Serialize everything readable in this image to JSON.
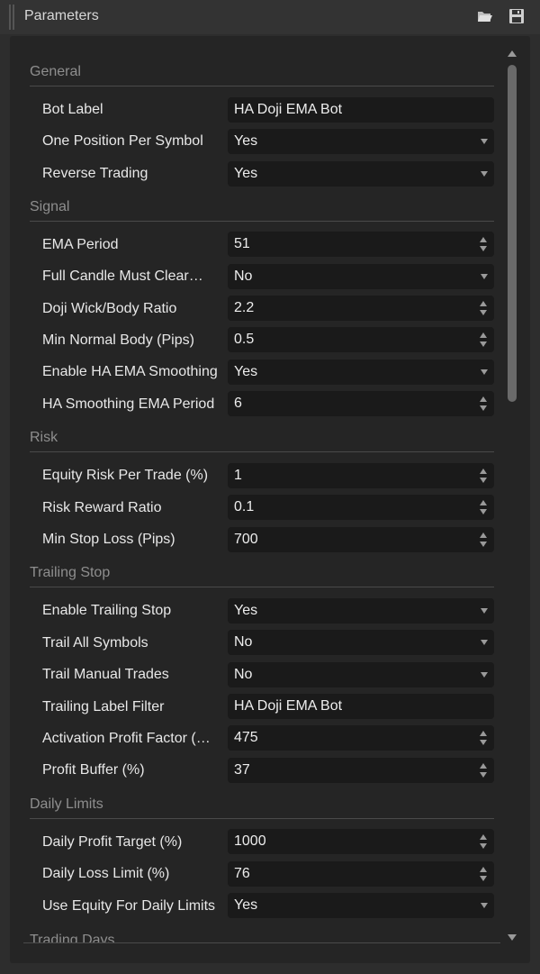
{
  "panel": {
    "title": "Parameters",
    "open_icon": "folder-open-icon",
    "save_icon": "save-icon"
  },
  "sections": {
    "general": {
      "title": "General",
      "bot_label": {
        "label": "Bot Label",
        "value": "HA Doji EMA Bot"
      },
      "one_position": {
        "label": "One Position Per Symbol",
        "value": "Yes"
      },
      "reverse_trading": {
        "label": "Reverse Trading",
        "value": "Yes"
      }
    },
    "signal": {
      "title": "Signal",
      "ema_period": {
        "label": "EMA Period",
        "value": "51"
      },
      "full_candle": {
        "label": "Full Candle Must Clear…",
        "value": "No"
      },
      "doji_ratio": {
        "label": "Doji Wick/Body Ratio",
        "value": "2.2"
      },
      "min_body": {
        "label": "Min Normal Body (Pips)",
        "value": "0.5"
      },
      "ha_smoothing": {
        "label": "Enable HA EMA Smoothing",
        "value": "Yes"
      },
      "ha_period": {
        "label": "HA Smoothing EMA Period",
        "value": "6"
      }
    },
    "risk": {
      "title": "Risk",
      "equity_risk": {
        "label": "Equity Risk Per Trade (%)",
        "value": "1"
      },
      "rr_ratio": {
        "label": "Risk Reward Ratio",
        "value": "0.1"
      },
      "min_sl": {
        "label": "Min Stop Loss (Pips)",
        "value": "700"
      }
    },
    "trailing": {
      "title": "Trailing Stop",
      "enable": {
        "label": "Enable Trailing Stop",
        "value": "Yes"
      },
      "all_symbols": {
        "label": "Trail All Symbols",
        "value": "No"
      },
      "manual": {
        "label": "Trail Manual Trades",
        "value": "No"
      },
      "label_filter": {
        "label": "Trailing Label Filter",
        "value": "HA Doji EMA Bot"
      },
      "activation": {
        "label": "Activation Profit Factor (…",
        "value": "475"
      },
      "buffer": {
        "label": "Profit Buffer (%)",
        "value": "37"
      }
    },
    "daily": {
      "title": "Daily Limits",
      "profit_target": {
        "label": "Daily Profit Target (%)",
        "value": "1000"
      },
      "loss_limit": {
        "label": "Daily Loss Limit (%)",
        "value": "76"
      },
      "use_equity": {
        "label": "Use Equity For Daily Limits",
        "value": "Yes"
      }
    },
    "trading_days": {
      "title": "Trading Days"
    }
  }
}
